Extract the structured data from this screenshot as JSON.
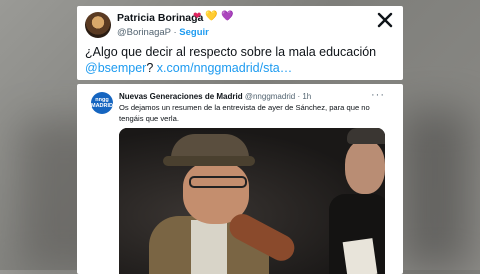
{
  "tweet": {
    "display_name": "Patricia Borinaga",
    "handle": "@BorinagaP",
    "separator": "·",
    "follow_label": "Seguir",
    "hearts": [
      "❤",
      "💛",
      "💜"
    ],
    "heart_colors": [
      "#e0245e",
      "#f5c518",
      "#a66ad8"
    ],
    "text_main": "¿Algo que decir al respecto sobre la mala educación",
    "mention": "@bsemper",
    "text_q": "?",
    "link": "x.com/nnggmadrid/sta…",
    "close_icon": "close-x-icon"
  },
  "quote": {
    "avatar_text_top": "nngg",
    "avatar_text_bottom": "MADRID",
    "display_name": "Nuevas Generaciones de Madrid",
    "handle_time": "@nnggmadrid · 1h",
    "more_icon": "···",
    "text": "Os dejamos un resumen de la entrevista de ayer de Sánchez, para que no tengáis que verla."
  },
  "colors": {
    "link_blue": "#1d9bf0",
    "avatar_blue": "#1565c0",
    "text_dark": "#0f1419",
    "text_gray": "#536471"
  }
}
